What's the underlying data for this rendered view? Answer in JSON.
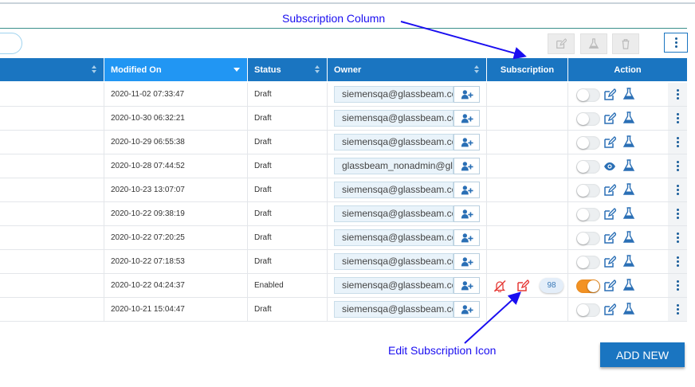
{
  "annotations": {
    "subscription_column": "Subscription Column",
    "edit_subscription_icon": "Edit Subscription Icon"
  },
  "toolbar": {
    "icons": [
      "edit-icon",
      "flask-icon",
      "trash-icon",
      "kebab-menu-icon"
    ]
  },
  "columns": {
    "name": "",
    "modified_on": "Modified On",
    "status": "Status",
    "owner": "Owner",
    "subscription": "Subscription",
    "action": "Action"
  },
  "rows": [
    {
      "modified_on": "2020-11-02 07:33:47",
      "status": "Draft",
      "owner": "siemensqa@glassbeam.com",
      "enabled": false,
      "action_icon": "edit-icon",
      "has_subscription": false
    },
    {
      "modified_on": "2020-10-30 06:32:21",
      "status": "Draft",
      "owner": "siemensqa@glassbeam.com",
      "enabled": false,
      "action_icon": "edit-icon",
      "has_subscription": false
    },
    {
      "modified_on": "2020-10-29 06:55:38",
      "status": "Draft",
      "owner": "siemensqa@glassbeam.com",
      "enabled": false,
      "action_icon": "edit-icon",
      "has_subscription": false
    },
    {
      "modified_on": "2020-10-28 07:44:52",
      "status": "Draft",
      "owner": "glassbeam_nonadmin@glassbeam.com",
      "enabled": false,
      "action_icon": "eye-icon",
      "has_subscription": false
    },
    {
      "modified_on": "2020-10-23 13:07:07",
      "status": "Draft",
      "owner": "siemensqa@glassbeam.com",
      "enabled": false,
      "action_icon": "edit-icon",
      "has_subscription": false
    },
    {
      "modified_on": "2020-10-22 09:38:19",
      "status": "Draft",
      "owner": "siemensqa@glassbeam.com",
      "enabled": false,
      "action_icon": "edit-icon",
      "has_subscription": false
    },
    {
      "modified_on": "2020-10-22 07:20:25",
      "status": "Draft",
      "owner": "siemensqa@glassbeam.com",
      "enabled": false,
      "action_icon": "edit-icon",
      "has_subscription": false
    },
    {
      "modified_on": "2020-10-22 07:18:53",
      "status": "Draft",
      "owner": "siemensqa@glassbeam.com",
      "enabled": false,
      "action_icon": "edit-icon",
      "has_subscription": false
    },
    {
      "modified_on": "2020-10-22 04:24:37",
      "status": "Enabled",
      "owner": "siemensqa@glassbeam.com",
      "enabled": true,
      "action_icon": "edit-icon",
      "has_subscription": true,
      "subscription_count": "98"
    },
    {
      "modified_on": "2020-10-21 15:04:47",
      "status": "Draft",
      "owner": "siemensqa@glassbeam.com",
      "enabled": false,
      "action_icon": "edit-icon",
      "has_subscription": false
    }
  ],
  "add_new_label": "ADD NEW",
  "colors": {
    "header": "#1a75c1",
    "header_active": "#2196f3",
    "toggle_on": "#f39223",
    "annotation": "#1a0ef0",
    "subscription_red": "#e53935"
  }
}
